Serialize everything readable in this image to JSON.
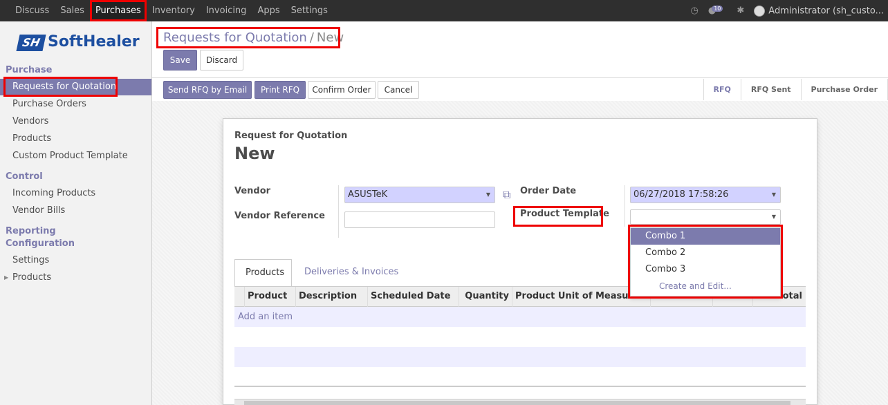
{
  "topbar": {
    "menu": [
      "Discuss",
      "Sales",
      "Purchases",
      "Inventory",
      "Invoicing",
      "Apps",
      "Settings"
    ],
    "active": "Purchases",
    "message_count": "10",
    "user": "Administrator (sh_custo..."
  },
  "logo": {
    "mark": "SH",
    "text": "SoftHealer"
  },
  "sidebar": {
    "sections": [
      "Purchase",
      "Control",
      "Reporting",
      "Configuration"
    ],
    "purchase_items": [
      "Requests for Quotation",
      "Purchase Orders",
      "Vendors",
      "Products",
      "Custom Product Template"
    ],
    "control_items": [
      "Incoming Products",
      "Vendor Bills"
    ],
    "config_items": [
      "Settings",
      "Products"
    ]
  },
  "breadcrumb": {
    "parent": "Requests for Quotation",
    "sep": "/",
    "current": "New"
  },
  "buttons": {
    "save": "Save",
    "discard": "Discard",
    "send_rfq": "Send RFQ by Email",
    "print_rfq": "Print RFQ",
    "confirm": "Confirm Order",
    "cancel": "Cancel"
  },
  "statusbar": [
    "RFQ",
    "RFQ Sent",
    "Purchase Order"
  ],
  "form": {
    "doc_type": "Request for Quotation",
    "title": "New",
    "vendor_label": "Vendor",
    "vendor_value": "ASUSTeK",
    "vendor_ref_label": "Vendor Reference",
    "vendor_ref_value": "",
    "order_date_label": "Order Date",
    "order_date_value": "06/27/2018 17:58:26",
    "product_template_label": "Product Template",
    "product_template_value": ""
  },
  "dropdown": {
    "options": [
      "Combo 1",
      "Combo 2",
      "Combo 3"
    ],
    "create": "Create and Edit..."
  },
  "tabs": [
    "Products",
    "Deliveries & Invoices"
  ],
  "table": {
    "headers": [
      "Product",
      "Description",
      "Scheduled Date",
      "Quantity",
      "Product Unit of Measure",
      "",
      "",
      "total"
    ],
    "add_item": "Add an item"
  }
}
